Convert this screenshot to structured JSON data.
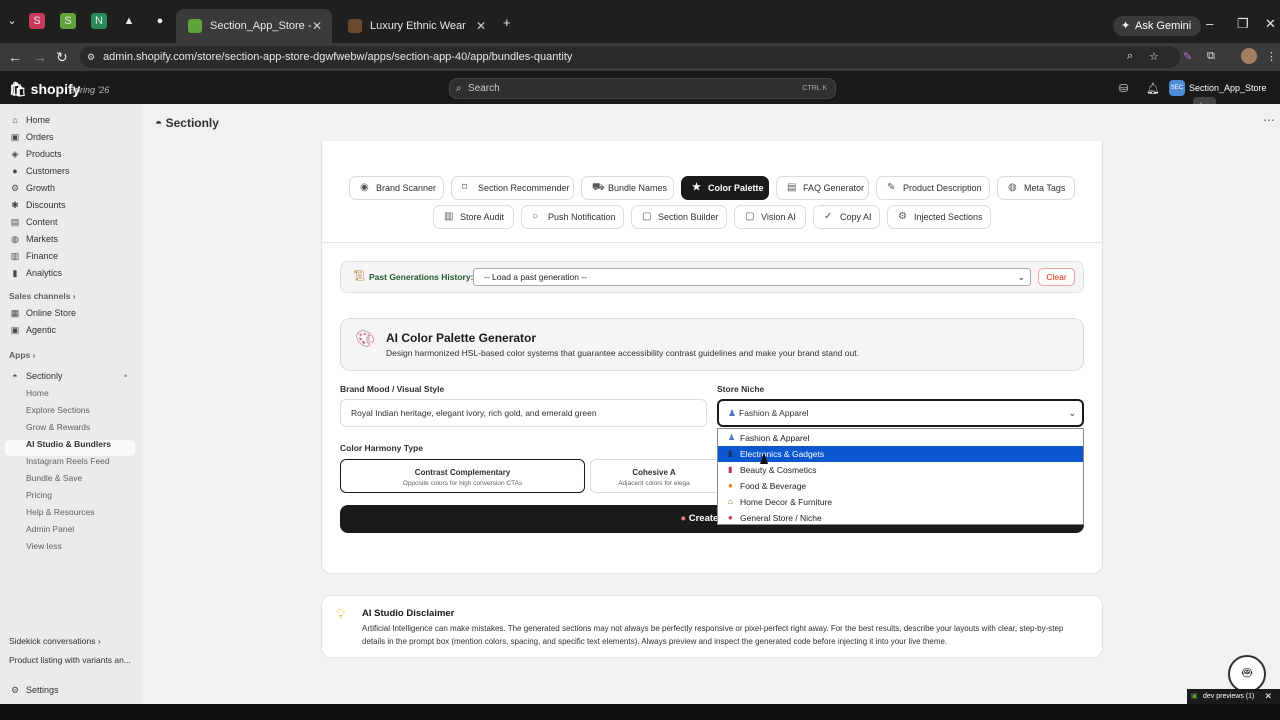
{
  "browser": {
    "tabs": [
      {
        "title": "Section_App_Store - Sectionly",
        "active": true
      },
      {
        "title": "Luxury Ethnic Wear",
        "active": false
      }
    ],
    "new_tab": "+",
    "gemini_label": "Ask Gemini",
    "url": "admin.shopify.com/store/section-app-store-dgwfwebw/apps/section-app-40/app/bundles-quantity"
  },
  "shopify_header": {
    "logo": "shopify",
    "edition": "Spring '26",
    "search_placeholder": "Search",
    "search_shortcut": "CTRL  K",
    "store_initials": "SEC",
    "store_name": "Section_App_Store",
    "store_badge": "dev"
  },
  "sidebar": {
    "items": [
      {
        "label": "Home",
        "icon": "home-icon"
      },
      {
        "label": "Orders",
        "icon": "orders-icon"
      },
      {
        "label": "Products",
        "icon": "tag-icon"
      },
      {
        "label": "Customers",
        "icon": "person-icon"
      },
      {
        "label": "Growth",
        "icon": "growth-icon"
      },
      {
        "label": "Discounts",
        "icon": "discount-icon"
      },
      {
        "label": "Content",
        "icon": "content-icon"
      },
      {
        "label": "Markets",
        "icon": "globe-icon"
      },
      {
        "label": "Finance",
        "icon": "bank-icon"
      },
      {
        "label": "Analytics",
        "icon": "chart-icon"
      }
    ],
    "sales_channels_label": "Sales channels",
    "channels": [
      {
        "label": "Online Store"
      },
      {
        "label": "Agentic"
      }
    ],
    "apps_label": "Apps",
    "app_name": "Sectionly",
    "app_subitems": [
      "Home",
      "Explore Sections",
      "Grow & Rewards",
      "AI Studio & Bundlers",
      "Instagram Reels Feed",
      "Bundle & Save",
      "Pricing",
      "Help & Resources",
      "Admin Panel",
      "View less"
    ],
    "sidekick_label": "Sidekick conversations",
    "sidekick_item": "Product listing with variants an...",
    "settings": "Settings"
  },
  "app": {
    "title": "Sectionly",
    "tools_row1": [
      {
        "label": "Brand Scanner",
        "icon": "eye-icon"
      },
      {
        "label": "Section Recommender",
        "icon": "bookmark-icon"
      },
      {
        "label": "Bundle Names",
        "icon": "cart-icon"
      },
      {
        "label": "Color Palette",
        "icon": "star-icon",
        "active": true
      },
      {
        "label": "FAQ Generator",
        "icon": "chat-icon"
      },
      {
        "label": "Product Description",
        "icon": "pencil-icon"
      },
      {
        "label": "Meta Tags",
        "icon": "globe-icon"
      }
    ],
    "tools_row2": [
      {
        "label": "Store Audit",
        "icon": "chart-icon"
      },
      {
        "label": "Push Notification",
        "icon": "bubble-icon"
      },
      {
        "label": "Section Builder",
        "icon": "lock-icon"
      },
      {
        "label": "Vision AI",
        "icon": "lock-icon"
      },
      {
        "label": "Copy AI",
        "icon": "check-icon"
      },
      {
        "label": "Injected Sections",
        "icon": "gear-icon"
      }
    ],
    "history_label": "Past Generations History:",
    "history_placeholder": "-- Load a past generation --",
    "clear_label": "Clear",
    "generator_title": "AI Color Palette Generator",
    "generator_desc": "Design harmonized HSL-based color systems that guarantee accessibility contrast guidelines and make your brand stand out.",
    "mood_label": "Brand Mood / Visual Style",
    "mood_value": "Royal Indian heritage, elegant ivory, rich gold, and emerald green",
    "niche_label": "Store Niche",
    "niche_value": "Fashion & Apparel",
    "niche_options": [
      {
        "label": "Fashion & Apparel",
        "icon": "dress-icon"
      },
      {
        "label": "Electronics & Gadgets",
        "icon": "phone-icon",
        "highlighted": true
      },
      {
        "label": "Beauty & Cosmetics",
        "icon": "lipstick-icon"
      },
      {
        "label": "Food & Beverage",
        "icon": "food-icon"
      },
      {
        "label": "Home Decor & Furniture",
        "icon": "house-icon"
      },
      {
        "label": "General Store / Niche",
        "icon": "shop-icon"
      }
    ],
    "harmony_label": "Color Harmony Type",
    "harmony_options": [
      {
        "title": "Contrast Complementary",
        "desc": "Opposite colors for high conversion CTAs",
        "selected": true
      },
      {
        "title": "Cohesive A",
        "desc": "Adjacent colors for elega",
        "selected": false
      }
    ],
    "create_label": "Create Co",
    "disclaimer_title": "AI Studio Disclaimer",
    "disclaimer_text": "Artificial Intelligence can make mistakes. The generated sections may not always be perfectly responsive or pixel-perfect right away. For the best results, describe your layouts with clear, step-by-step details in the prompt box (mention colors, spacing, and specific text elements). Always preview and inspect the generated code before injecting it into your live theme."
  },
  "dev_previews": "dev previews (1)",
  "colors": {
    "accent_dark": "#1a1a1a",
    "highlight_blue": "#0a57d0",
    "clear_red": "#d82c0d"
  }
}
